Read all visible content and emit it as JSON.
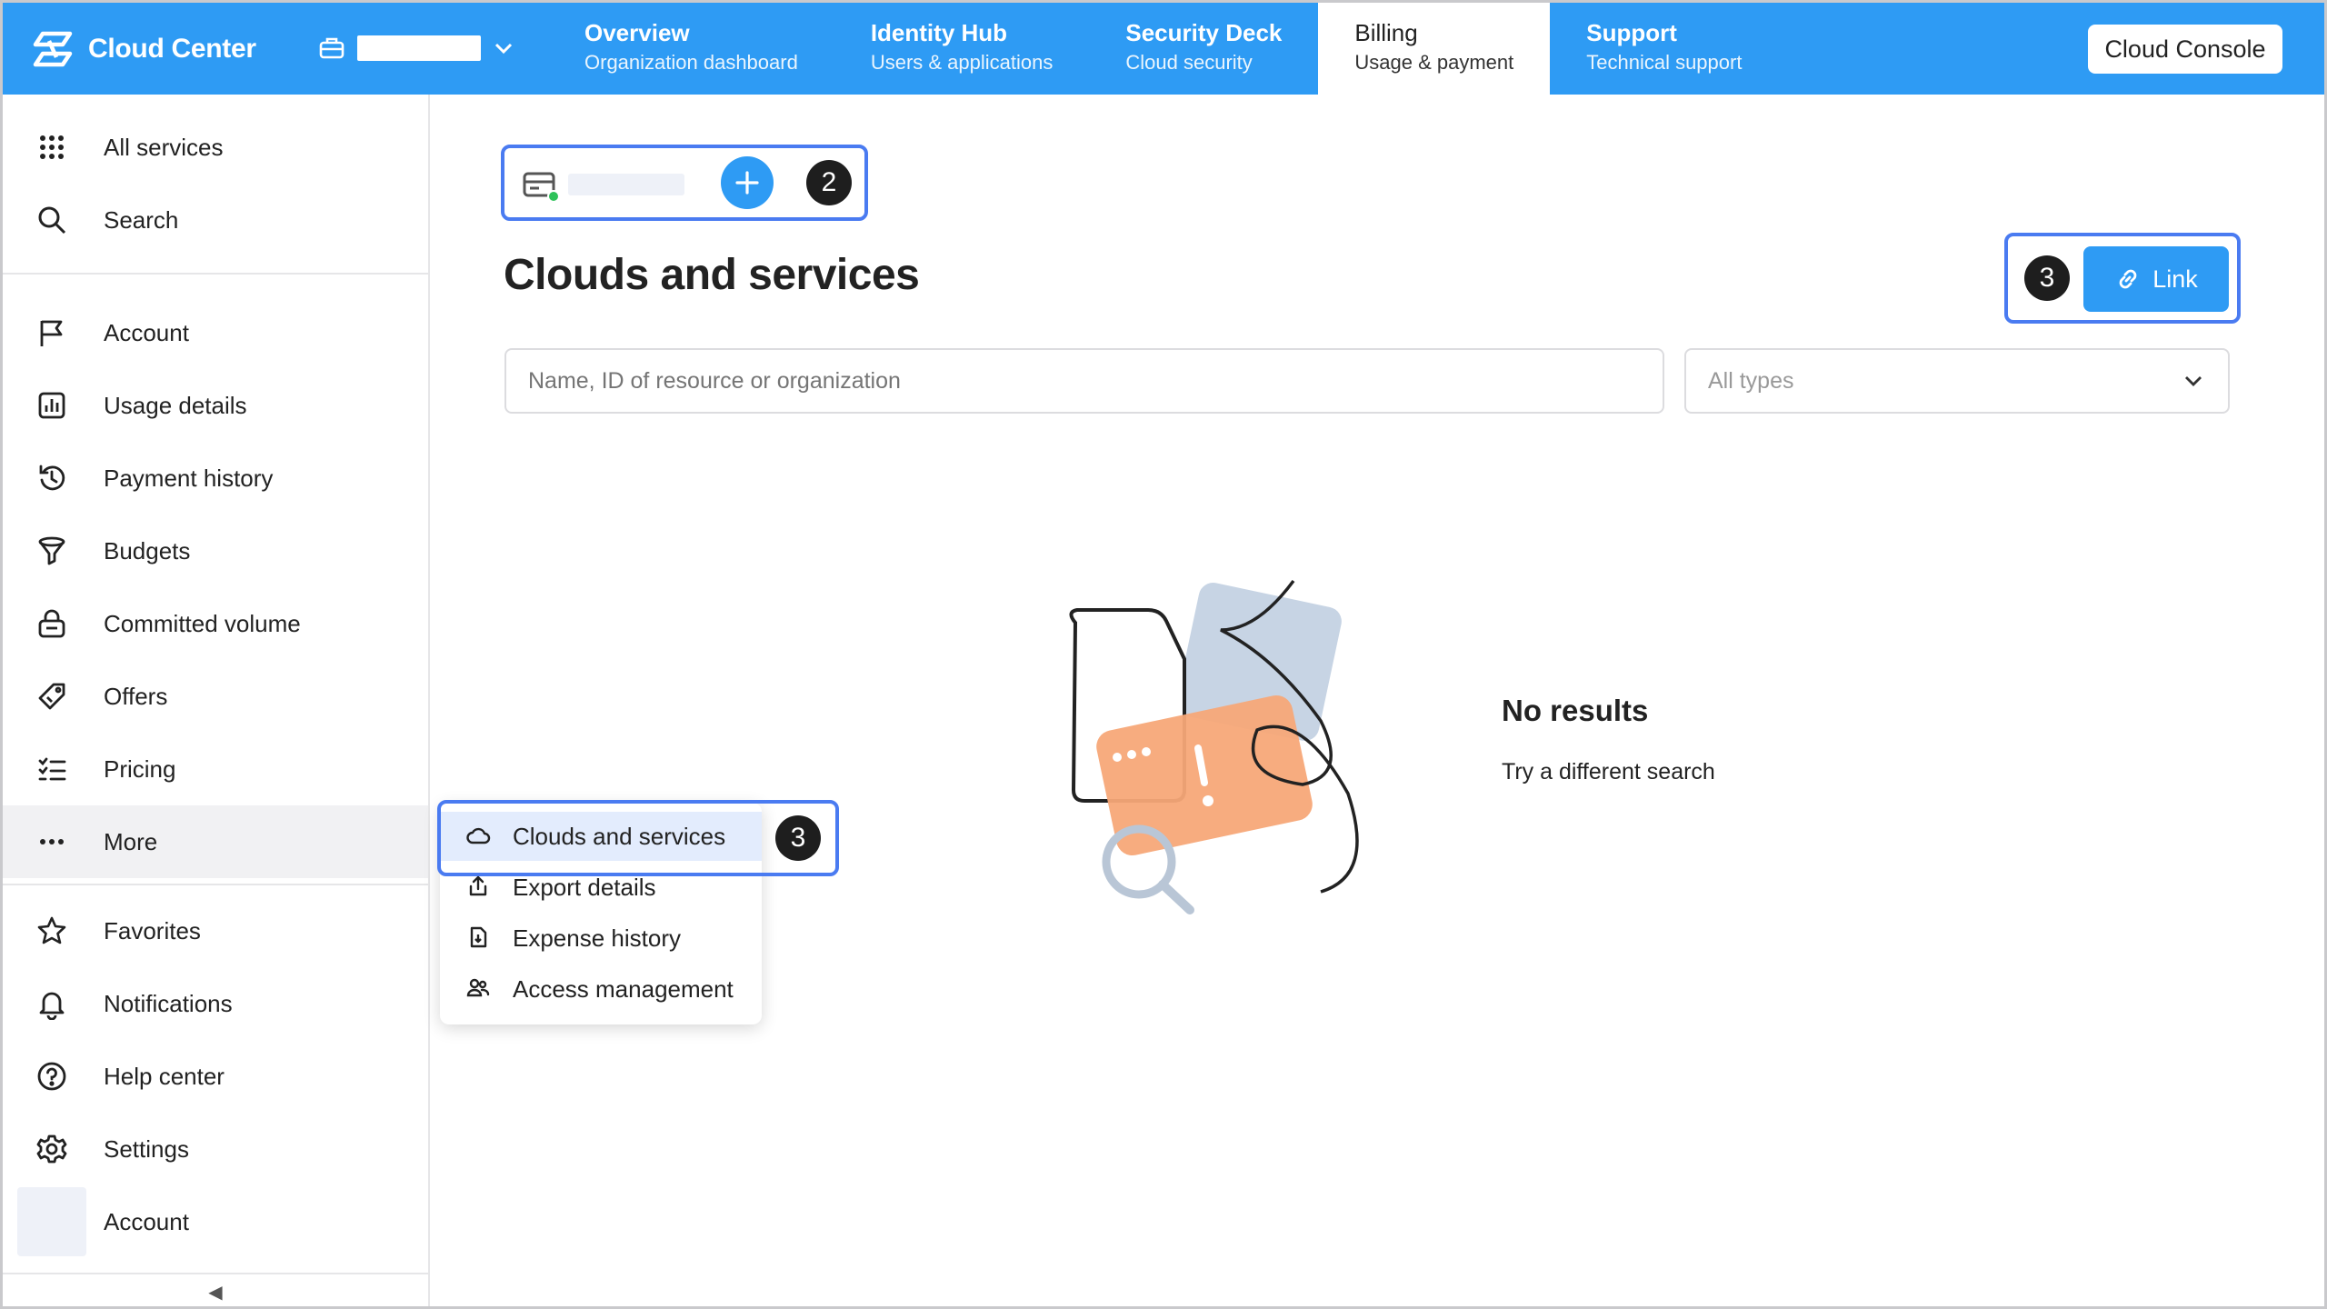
{
  "header": {
    "brand": "Cloud Center",
    "tabs": [
      {
        "title": "Overview",
        "subtitle": "Organization dashboard",
        "active": false
      },
      {
        "title": "Identity Hub",
        "subtitle": "Users & applications",
        "active": false
      },
      {
        "title": "Security Deck",
        "subtitle": "Cloud security",
        "active": false
      },
      {
        "title": "Billing",
        "subtitle": "Usage & payment",
        "active": true
      },
      {
        "title": "Support",
        "subtitle": "Technical support",
        "active": false
      }
    ],
    "console_button": "Cloud Console"
  },
  "sidebar": {
    "top": [
      {
        "label": "All services",
        "icon": "grid-icon"
      },
      {
        "label": "Search",
        "icon": "search-icon"
      }
    ],
    "items": [
      {
        "label": "Account",
        "icon": "flag-icon"
      },
      {
        "label": "Usage details",
        "icon": "chart-icon"
      },
      {
        "label": "Payment history",
        "icon": "history-icon"
      },
      {
        "label": "Budgets",
        "icon": "funnel-icon"
      },
      {
        "label": "Committed volume",
        "icon": "lock-icon"
      },
      {
        "label": "Offers",
        "icon": "tag-icon"
      },
      {
        "label": "Pricing",
        "icon": "list-icon"
      },
      {
        "label": "More",
        "icon": "more-icon"
      }
    ],
    "bottom": [
      {
        "label": "Favorites",
        "icon": "star-icon"
      },
      {
        "label": "Notifications",
        "icon": "bell-icon"
      },
      {
        "label": "Help center",
        "icon": "help-icon"
      },
      {
        "label": "Settings",
        "icon": "gear-icon"
      },
      {
        "label": "Account",
        "icon": "avatar"
      }
    ],
    "collapse": "◀"
  },
  "main": {
    "badges": {
      "wallet": "2",
      "link": "3",
      "menu": "3"
    },
    "title": "Clouds and services",
    "link_button": "Link",
    "search_placeholder": "Name, ID of resource or organization",
    "type_select": "All types",
    "empty_title": "No results",
    "empty_subtitle": "Try a different search"
  },
  "menu": {
    "items": [
      {
        "label": "Clouds and services",
        "icon": "cloud-icon",
        "selected": true
      },
      {
        "label": "Export details",
        "icon": "export-icon",
        "selected": false
      },
      {
        "label": "Expense history",
        "icon": "file-icon",
        "selected": false
      },
      {
        "label": "Access management",
        "icon": "users-icon",
        "selected": false
      }
    ]
  },
  "colors": {
    "accent": "#2e9bf4",
    "highlight_outline": "#4a7bf1",
    "selected_bg": "#e3ecfd"
  }
}
